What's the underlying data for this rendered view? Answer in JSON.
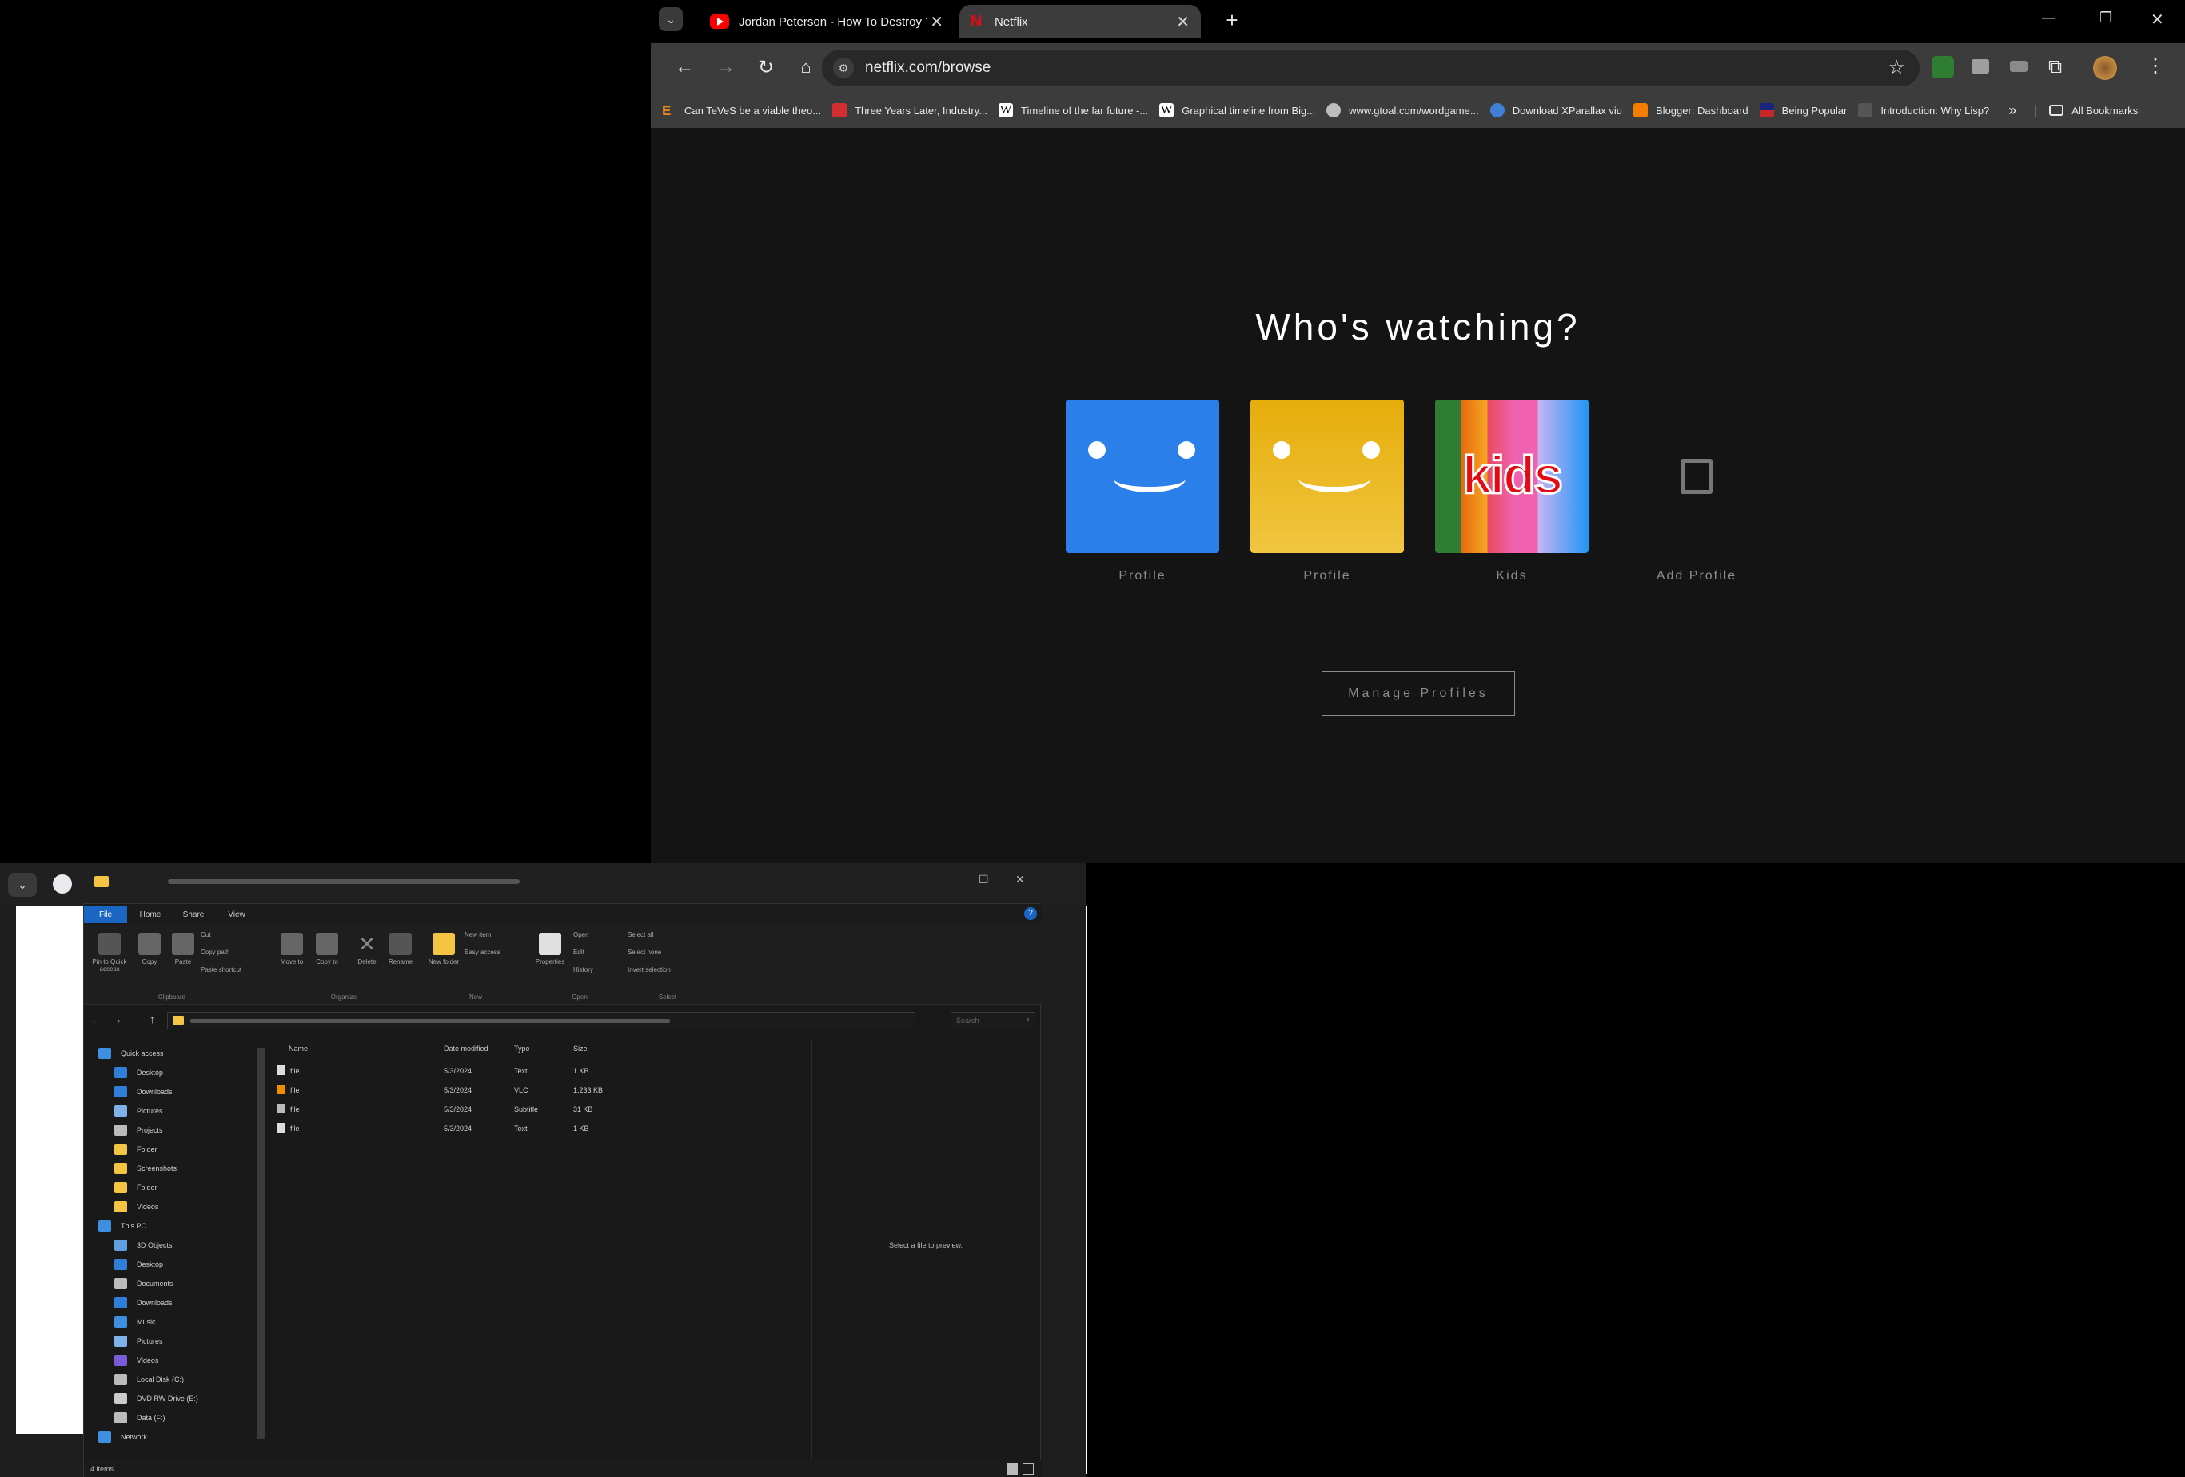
{
  "chrome": {
    "tabs": [
      {
        "label": "Jordan Peterson - How To Destroy Your N",
        "active": false
      },
      {
        "label": "Netflix",
        "active": true
      }
    ],
    "new_tab": "+",
    "url": "netflix.com/browse",
    "window_controls": {
      "minimize": "—",
      "restore": "❐",
      "close": "✕"
    },
    "bookmarks": [
      {
        "label": "Can TeVeS be a viable theo...",
        "icon": "e-icon",
        "color": "#e8871e"
      },
      {
        "label": "Three Years Later, Industry...",
        "icon": "news-icon",
        "color": "#d32f2f"
      },
      {
        "label": "Timeline of the far future -...",
        "icon": "wikipedia-icon",
        "color": "#ffffff"
      },
      {
        "label": "Graphical timeline from Big...",
        "icon": "wikipedia-icon",
        "color": "#ffffff"
      },
      {
        "label": "www.gtoal.com/wordgame...",
        "icon": "globe-icon",
        "color": "#bdbdbd"
      },
      {
        "label": "Download XParallax viu",
        "icon": "xparallax-icon",
        "color": "#3f7fd8"
      },
      {
        "label": "Blogger: Dashboard",
        "icon": "blogger-icon",
        "color": "#f57d00"
      },
      {
        "label": "Being Popular",
        "icon": "flag-icon",
        "color": "#c62828"
      },
      {
        "label": "Introduction: Why Lisp?",
        "icon": "page-icon",
        "color": "#555555"
      }
    ],
    "all_bookmarks": "All Bookmarks",
    "overflow": "»"
  },
  "netflix": {
    "heading": "Who's watching?",
    "profiles": [
      {
        "name": "Profile",
        "type": "blue-smile",
        "color": "#2a7fe8"
      },
      {
        "name": "Profile",
        "type": "yellow-smile",
        "color": "#e6b214"
      },
      {
        "name": "Kids",
        "type": "kids",
        "kids_label": "kids"
      },
      {
        "name": "Add Profile",
        "type": "add"
      }
    ],
    "manage_button": "Manage Profiles"
  },
  "explorer": {
    "ribbon_tabs": [
      "File",
      "Home",
      "Share",
      "View"
    ],
    "ribbon_groups": [
      "Clipboard",
      "Organize",
      "New",
      "Open",
      "Select"
    ],
    "ribbon_buttons": [
      "Pin to Quick access",
      "Copy",
      "Paste",
      "Cut",
      "Copy path",
      "Paste shortcut",
      "Move to",
      "Copy to",
      "Delete",
      "Rename",
      "New folder",
      "New item",
      "Easy access",
      "Properties",
      "Open",
      "Edit",
      "History",
      "Select all",
      "Select none",
      "Invert selection"
    ],
    "search_placeholder": "Search",
    "nav_items": [
      {
        "label": "Quick access",
        "icon": "star-icon",
        "indent": 0
      },
      {
        "label": "Desktop",
        "icon": "desktop-icon",
        "indent": 1
      },
      {
        "label": "Downloads",
        "icon": "download-icon",
        "indent": 1
      },
      {
        "label": "Pictures",
        "icon": "pictures-icon",
        "indent": 1
      },
      {
        "label": "Projects",
        "icon": "doc-icon",
        "indent": 1
      },
      {
        "label": "Folder",
        "icon": "folder-icon",
        "indent": 1
      },
      {
        "label": "Screenshots",
        "icon": "folder-icon",
        "indent": 1
      },
      {
        "label": "Folder",
        "icon": "folder-icon",
        "indent": 1
      },
      {
        "label": "Videos",
        "icon": "folder-icon",
        "indent": 1
      },
      {
        "label": "This PC",
        "icon": "pc-icon",
        "indent": 0
      },
      {
        "label": "3D Objects",
        "icon": "cube-icon",
        "indent": 1
      },
      {
        "label": "Desktop",
        "icon": "desktop-icon",
        "indent": 1
      },
      {
        "label": "Documents",
        "icon": "doc-icon",
        "indent": 1
      },
      {
        "label": "Downloads",
        "icon": "download-icon",
        "indent": 1
      },
      {
        "label": "Music",
        "icon": "music-icon",
        "indent": 1
      },
      {
        "label": "Pictures",
        "icon": "pictures-icon",
        "indent": 1
      },
      {
        "label": "Videos",
        "icon": "video-icon",
        "indent": 1
      },
      {
        "label": "Local Disk (C:)",
        "icon": "drive-icon",
        "indent": 1
      },
      {
        "label": "DVD RW Drive (E:)",
        "icon": "disc-icon",
        "indent": 1
      },
      {
        "label": "Data (F:)",
        "icon": "drive-icon",
        "indent": 1
      },
      {
        "label": "Network",
        "icon": "network-icon",
        "indent": 0
      }
    ],
    "columns": [
      "Name",
      "Date modified",
      "Type",
      "Size"
    ],
    "files": [
      {
        "name": "file",
        "date": "5/3/2024",
        "type": "Text",
        "size": "1 KB",
        "icon": "text-file-icon"
      },
      {
        "name": "file",
        "date": "5/3/2024",
        "type": "VLC",
        "size": "1,233 KB",
        "icon": "vlc-icon"
      },
      {
        "name": "file",
        "date": "5/3/2024",
        "type": "Subtitle",
        "size": "31 KB",
        "icon": "subtitle-file-icon"
      },
      {
        "name": "file",
        "date": "5/3/2024",
        "type": "Text",
        "size": "1 KB",
        "icon": "text-file-icon"
      }
    ],
    "preview_text": "Select a file to preview.",
    "status": "4 items"
  }
}
